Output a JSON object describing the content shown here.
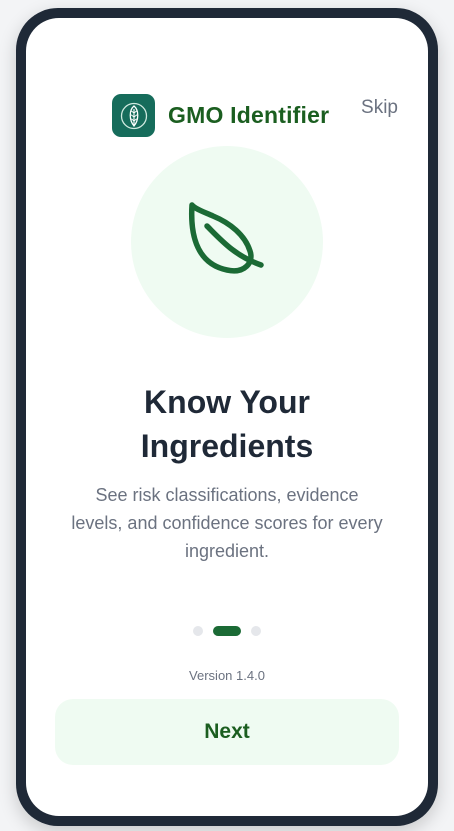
{
  "header": {
    "app_name": "GMO Identifier",
    "logo_icon": "leaf-icon",
    "skip_label": "Skip"
  },
  "onboarding": {
    "hero_icon": "leaf-icon",
    "title_line1": "Know Your",
    "title_line2": "Ingredients",
    "desc_line1": "See risk classifications, evidence",
    "desc_line2": "levels, and confidence scores for every",
    "desc_line3": "ingredient.",
    "current_step": 2,
    "total_steps": 3
  },
  "footer": {
    "version": "Version 1.4.0",
    "next_label": "Next"
  },
  "colors": {
    "brand_green": "#1b5e20",
    "logo_bg": "#166c5b",
    "light_green": "#effbf2",
    "dark_frame": "#1f2937"
  }
}
